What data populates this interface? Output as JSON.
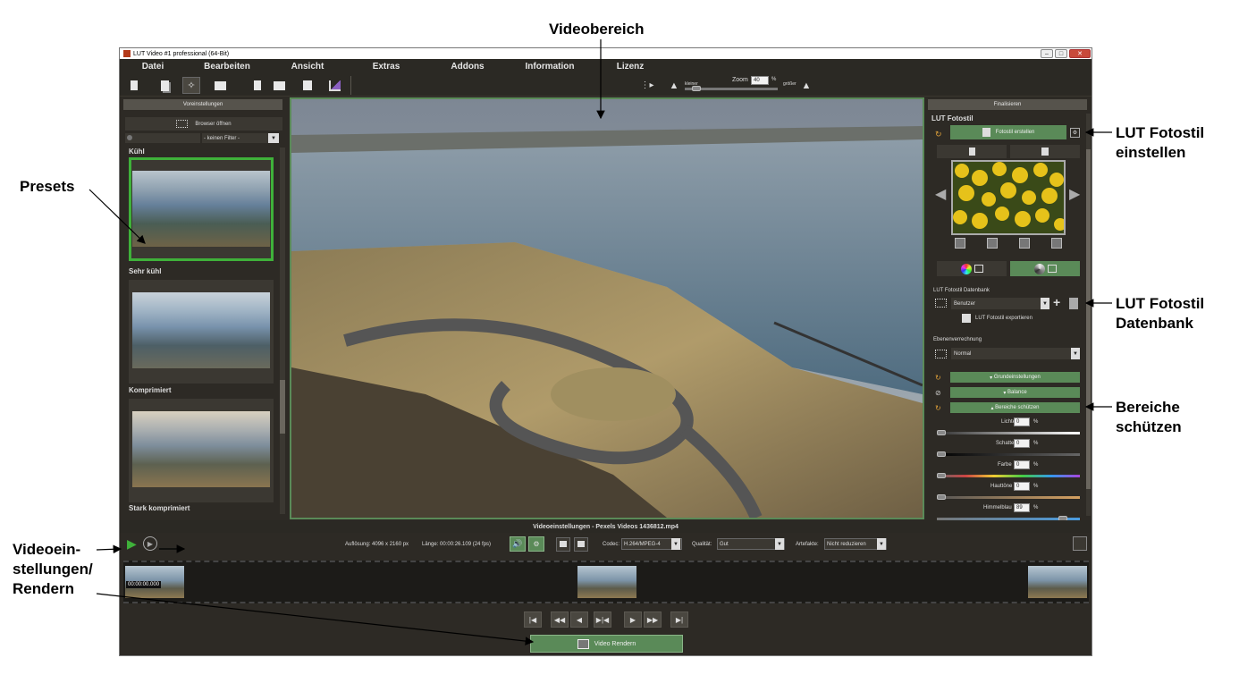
{
  "callouts": {
    "videobereich": "Videobereich",
    "presets": "Presets",
    "lut_einstellen_1": "LUT Fotostil",
    "lut_einstellen_2": "einstellen",
    "lut_datenbank_1": "LUT Fotostil",
    "lut_datenbank_2": "Datenbank",
    "bereiche_1": "Bereiche",
    "bereiche_2": "schützen",
    "video_1": "Videoein-",
    "video_2": "stellungen/",
    "video_3": "Rendern"
  },
  "window": {
    "title": "LUT Video #1 professional (64-Bit)"
  },
  "menu": [
    "Datei",
    "Bearbeiten",
    "Ansicht",
    "Extras",
    "Addons",
    "Information",
    "Lizenz"
  ],
  "zoom": {
    "label": "Zoom",
    "value": "40",
    "unit": "%",
    "smaller": "kleiner",
    "larger": "größer",
    "level": 0.4
  },
  "left_panel": {
    "header": "Voreinstellungen",
    "browser_button": "Browser öffnen",
    "filter_value": "- keinen Filter -",
    "presets": [
      {
        "label": "Kühl"
      },
      {
        "label": "Sehr kühl"
      },
      {
        "label": "Komprimiert"
      },
      {
        "label": "Stark komprimiert"
      }
    ]
  },
  "right_panel": {
    "header": "Finalisieren",
    "section_title": "LUT Fotostil",
    "create_button": "Fotostil erstellen",
    "db_label": "LUT Fotostil Datenbank",
    "db_value": "Benutzer",
    "export_label": "LUT Fotostil exportieren",
    "blend_label": "Ebenenverrechnung",
    "blend_value": "Normal",
    "groups": [
      "Grundeinstellungen",
      "Balance",
      "Bereiche schützen"
    ],
    "sliders": [
      {
        "label": "Lichter",
        "value": "0",
        "unit": "%"
      },
      {
        "label": "Schatten",
        "value": "0",
        "unit": "%"
      },
      {
        "label": "Farbe",
        "value": "0",
        "unit": "%"
      },
      {
        "label": "Hauttöne",
        "value": "0",
        "unit": "%"
      },
      {
        "label": "Himmelblau",
        "value": "89",
        "unit": "%"
      }
    ]
  },
  "video_settings": {
    "title": "Videoeinstellungen - Pexels Videos 1436812.mp4",
    "resolution": "Auflösung: 4096 x 2160 px",
    "length": "Länge: 00:00:26.109  (24 fps)",
    "codec_label": "Codec:",
    "codec_value": "H.264/MPEG-4",
    "quality_label": "Qualität:",
    "quality_value": "Gut",
    "artifacts_label": "Artefakte:",
    "artifacts_value": "Nicht reduzieren",
    "timecode": "00:00:00.000",
    "render_button": "Video Rendern"
  },
  "colors": {
    "accent_green": "#5a8a58",
    "bg_dark": "#2d2a25",
    "selection_green": "#3fb13a"
  }
}
